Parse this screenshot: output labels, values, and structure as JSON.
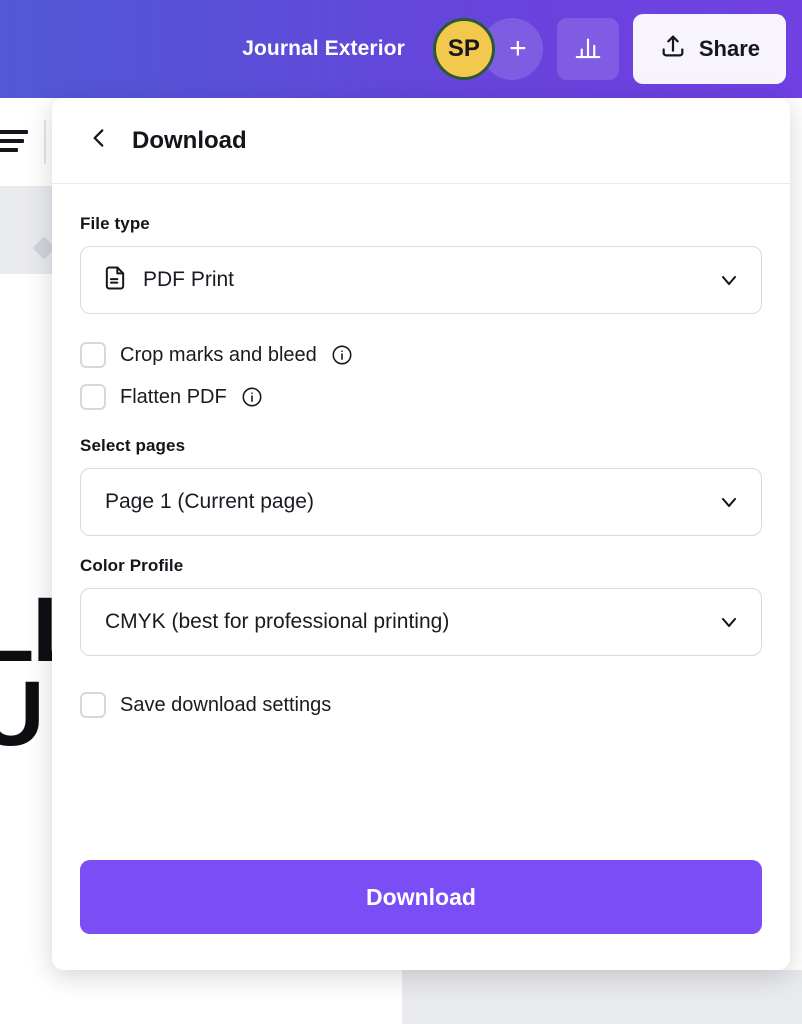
{
  "topbar": {
    "document_title": "Journal Exterior",
    "avatar_initials": "SP",
    "avatar_bg_color": "#f2c94c",
    "avatar_border_color": "#2c5833",
    "add_collaborator_label": "+",
    "chart_icon_name": "bar-chart-icon",
    "share_label": "Share",
    "gradient_start": "#5159d6",
    "gradient_end": "#7040e3"
  },
  "panel": {
    "title": "Download",
    "back_icon_name": "chevron-left-icon",
    "file_type": {
      "label": "File type",
      "value": "PDF Print",
      "icon_name": "document-icon"
    },
    "options": [
      {
        "label": "Crop marks and bleed",
        "checked": false,
        "has_info": true
      },
      {
        "label": "Flatten PDF",
        "checked": false,
        "has_info": true
      }
    ],
    "select_pages": {
      "label": "Select pages",
      "value": "Page 1 (Current page)"
    },
    "color_profile": {
      "label": "Color Profile",
      "value": "CMYK (best for professional printing)"
    },
    "save_settings": {
      "label": "Save download settings",
      "checked": false
    },
    "primary_button": {
      "label": "Download",
      "color": "#7b4df5"
    }
  },
  "background": {
    "align_icon_name": "align-left-icon",
    "design_text": "LL\nU"
  }
}
